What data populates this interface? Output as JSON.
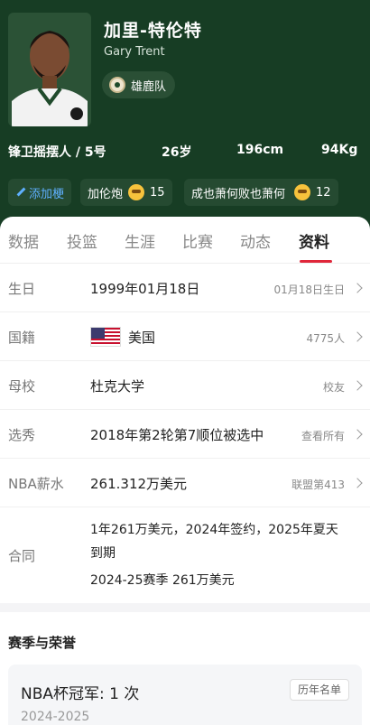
{
  "player": {
    "name_cn": "加里-特伦特",
    "name_en": "Gary Trent",
    "team": "雄鹿队",
    "position_number": "锋卫摇摆人 / 5号",
    "age": "26岁",
    "height": "196cm",
    "weight": "94Kg"
  },
  "tags": {
    "add": "添加梗",
    "tag1_text": "加伦炮",
    "tag1_count": "15",
    "tag2_text": "成也萧何败也萧何",
    "tag2_count": "12"
  },
  "tabs": [
    "数据",
    "投篮",
    "生涯",
    "比赛",
    "动态",
    "资料"
  ],
  "profile": {
    "birthday": {
      "label": "生日",
      "value": "1999年01月18日",
      "right": "01月18日生日"
    },
    "nationality": {
      "label": "国籍",
      "value": "美国",
      "right": "4775人"
    },
    "school": {
      "label": "母校",
      "value": "杜克大学",
      "right": "校友"
    },
    "draft": {
      "label": "选秀",
      "value": "2018年第2轮第7顺位被选中",
      "right": "查看所有"
    },
    "salary": {
      "label": "NBA薪水",
      "value": "261.312万美元",
      "right": "联盟第413"
    },
    "contract": {
      "label": "合同",
      "line1": "1年261万美元，2024年签约，2025年夏天",
      "line2": "到期",
      "line3": "2024-25赛季 261万美元"
    }
  },
  "honors": {
    "section_title": "赛季与荣誉",
    "title": "NBA杯冠军: 1 次",
    "button": "历年名单",
    "year": "2024-2025"
  }
}
